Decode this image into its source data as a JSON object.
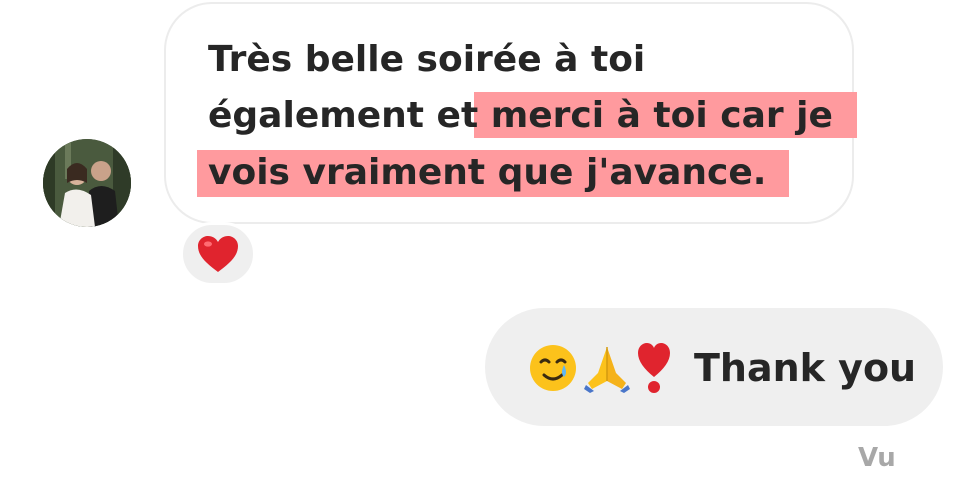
{
  "conversation": {
    "incoming": {
      "lines": [
        "Très belle soirée à toi",
        "également et ",
        "merci à toi car je",
        "vois vraiment que j'avance."
      ],
      "highlight_color": "#ff9a9e",
      "reaction": "heart-emoji"
    },
    "outgoing": {
      "emojis": [
        "smiling-face-with-tear-emoji",
        "folded-hands-emoji",
        "heavy-exclamation-heart-emoji"
      ],
      "text": "Thank you"
    },
    "status": "Vu"
  },
  "colors": {
    "text": "#262626",
    "bubble_out_bg": "#efefef",
    "bubble_in_border": "#ececec",
    "status": "#a8a8a8",
    "heart": "#e0242e"
  }
}
